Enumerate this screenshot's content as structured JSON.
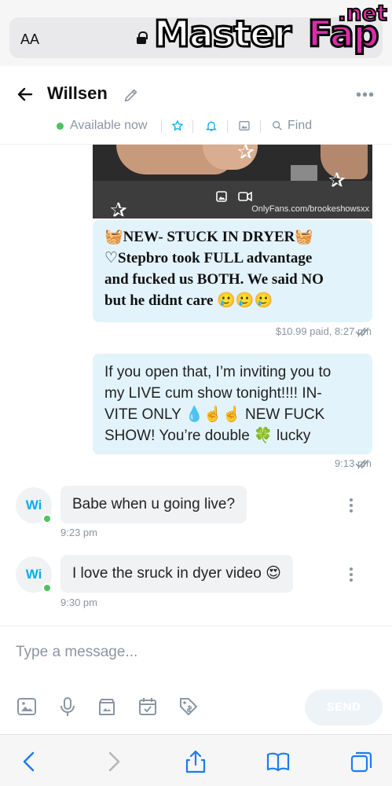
{
  "browser": {
    "text_size_label": "AA",
    "url": "",
    "watermark": {
      "master": "Master",
      "fap": "Fap",
      "net": ".net"
    }
  },
  "chat_header": {
    "contact_name": "Willsen",
    "status": "Available now",
    "find_label": "Find",
    "icons": [
      "back-arrow-icon",
      "pencil-icon",
      "more-icon",
      "star-icon",
      "bell-icon",
      "image-icon",
      "search-icon"
    ]
  },
  "messages": {
    "media_credit": "OnlyFans.com/brookeshowsxx",
    "outgoing": [
      {
        "lines": [
          "🧺NEW- STUCK IN DRYER🧺",
          "♡Stepbro took FULL advantage",
          "and fucked us BOTH. We said NO",
          "but he didnt care 🥲🥲🥲"
        ],
        "meta": "$10.99 paid, 8:27 pm"
      },
      {
        "lines": [
          "If you open that, I’m inviting you to",
          "my LIVE cum show tonight!!!! IN-",
          "VITE ONLY 💧☝️☝️ NEW FUCK",
          "SHOW! You’re double 🍀 lucky"
        ],
        "meta": "9:13 pm"
      }
    ],
    "incoming": [
      {
        "avatar": "Wi",
        "text": "Babe when u going live?",
        "time": "9:23 pm"
      },
      {
        "avatar": "Wi",
        "text": "I love the sruck in dyer video 😍",
        "time": "9:30 pm"
      }
    ]
  },
  "composer": {
    "placeholder": "Type a message...",
    "send_label": "SEND",
    "tools": [
      "image-icon",
      "microphone-icon",
      "vault-icon",
      "calendar-check-icon",
      "price-tag-icon"
    ]
  },
  "colors": {
    "accent": "#00aff0",
    "outgoing_bubble": "#e3f3fb",
    "incoming_bubble": "#f0f2f4",
    "muted": "#8a96a3",
    "online": "#4cc35f"
  }
}
